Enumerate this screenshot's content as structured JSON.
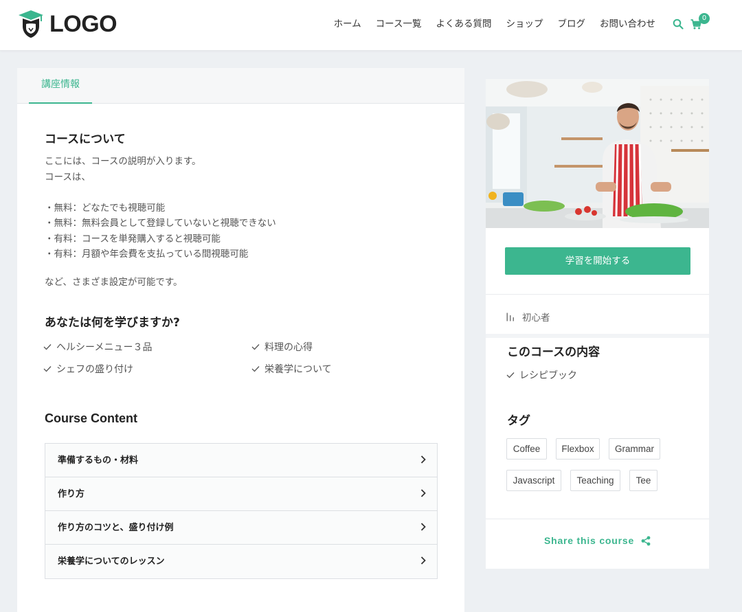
{
  "header": {
    "logo_text": "LOGO",
    "nav": [
      "ホーム",
      "コース一覧",
      "よくある質問",
      "ショップ",
      "ブログ",
      "お問い合わせ"
    ],
    "cart_count": "0"
  },
  "colors": {
    "accent": "#3cb68f",
    "background": "#edf0f3"
  },
  "main": {
    "tab_label": "講座情報",
    "about_title": "コースについて",
    "description": [
      "ここには、コースの説明が入ります。",
      "コースは、",
      "",
      "・無料：どなたでも視聴可能",
      "・無料：無料会員として登録していないと視聴できない",
      "・有料：コースを単発購入すると視聴可能",
      "・有料：月額や年会費を支払っている間視聴可能"
    ],
    "description_end": "など、さまざま設定が可能です。",
    "learn_title": "あなたは何を学びますか?",
    "learn_items": [
      "ヘルシーメニュー３品",
      "料理の心得",
      "シェフの盛り付け",
      "栄養学について"
    ],
    "content_title": "Course Content",
    "sections": [
      "準備するもの・材料",
      "作り方",
      "作り方のコツと、盛り付け例",
      "栄養学についてのレッスン"
    ]
  },
  "sidebar": {
    "start_button": "学習を開始する",
    "level": "初心者",
    "includes_title": "このコースの内容",
    "includes": [
      "レシピブック"
    ],
    "tags_title": "タグ",
    "tags": [
      "Coffee",
      "Flexbox",
      "Grammar",
      "Javascript",
      "Teaching",
      "Tee"
    ],
    "share_label": "Share this course"
  }
}
